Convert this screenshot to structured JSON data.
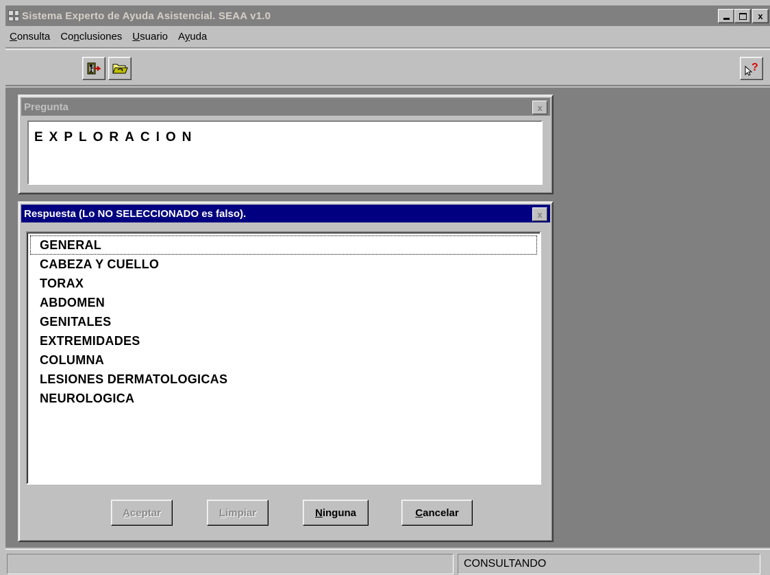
{
  "window": {
    "title": "Sistema Experto de Ayuda Asistencial. SEAA v1.0",
    "min_label": "_",
    "close_label": "x"
  },
  "menu": {
    "items": [
      {
        "mnemonic": "C",
        "rest": "onsulta"
      },
      {
        "pre": "Co",
        "mnemonic": "n",
        "rest": "clusiones"
      },
      {
        "mnemonic": "U",
        "rest": "suario"
      },
      {
        "pre": "A",
        "mnemonic": "y",
        "rest": "uda"
      }
    ]
  },
  "toolbar": {
    "icons": [
      "exit-door-icon",
      "open-folder-icon",
      "help-pointer-icon"
    ]
  },
  "pregunta": {
    "title": "Pregunta",
    "text": "EXPLORACION"
  },
  "respuesta": {
    "title": "Respuesta (Lo NO SELECCIONADO es falso).",
    "options": [
      "GENERAL",
      "CABEZA Y CUELLO",
      "TORAX",
      "ABDOMEN",
      "GENITALES",
      "EXTREMIDADES",
      "COLUMNA",
      "LESIONES DERMATOLOGICAS",
      "NEUROLOGICA"
    ],
    "focused_index": 0,
    "buttons": {
      "aceptar": {
        "mnemonic": "A",
        "rest": "ceptar",
        "enabled": false
      },
      "limpiar": {
        "mnemonic": "L",
        "rest": "impiar",
        "enabled": false
      },
      "ninguna": {
        "mnemonic": "N",
        "rest": "inguna",
        "enabled": true
      },
      "cancelar": {
        "mnemonic": "C",
        "rest": "ancelar",
        "enabled": true
      }
    }
  },
  "status": {
    "state": "CONSULTANDO"
  },
  "colors": {
    "face": "#c0c0c0",
    "workspace": "#808080",
    "active_title": "#000080",
    "inactive_title": "#808080"
  }
}
